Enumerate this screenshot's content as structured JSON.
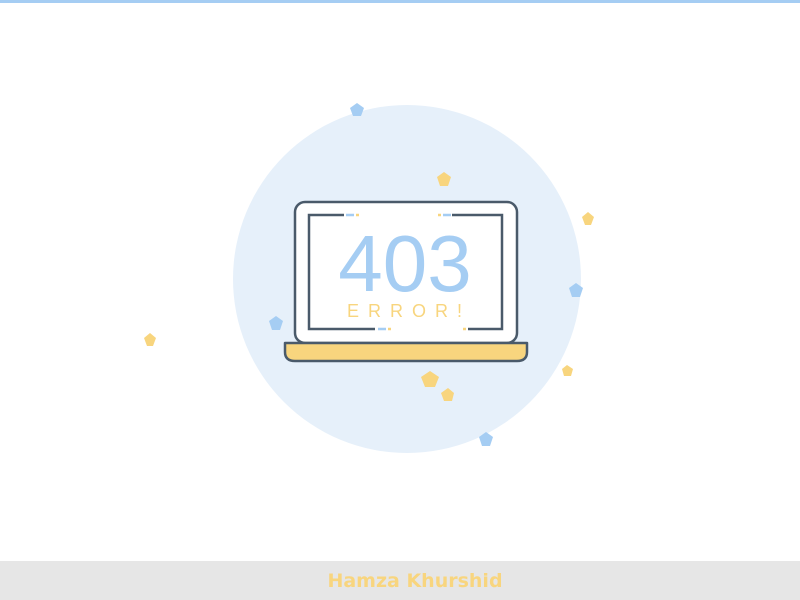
{
  "error": {
    "code": "403",
    "label": "ERROR!"
  },
  "footer": {
    "author": "Hamza Khurshid"
  },
  "colors": {
    "accent_blue": "#a5cdf3",
    "accent_yellow": "#f8d57e",
    "outline": "#4a5a6a",
    "circle_bg": "#e6f0fa",
    "footer_bg": "#e6e6e6"
  }
}
